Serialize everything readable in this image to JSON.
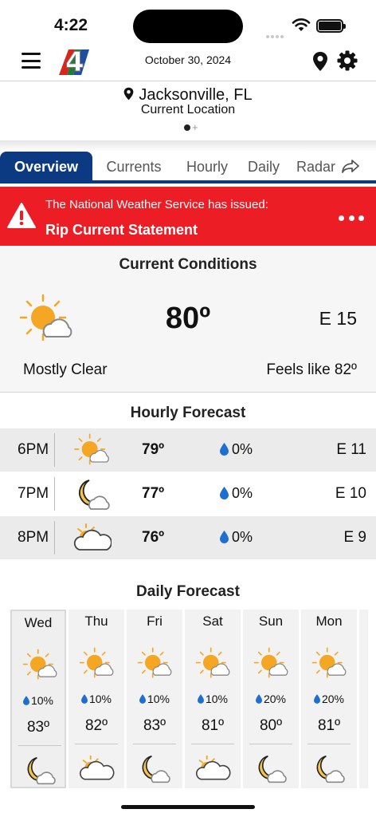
{
  "status_bar": {
    "time": "4:22"
  },
  "header": {
    "date": "October 30, 2024"
  },
  "location": {
    "city": "Jacksonville, FL",
    "subtitle": "Current Location"
  },
  "tabs": [
    {
      "label": "Overview",
      "active": true
    },
    {
      "label": "Currents",
      "active": false
    },
    {
      "label": "Hourly",
      "active": false
    },
    {
      "label": "Daily",
      "active": false
    },
    {
      "label": "Radar",
      "active": false
    }
  ],
  "alert": {
    "line1": "The National Weather Service has issued:",
    "line2": "Rip Current Statement",
    "color": "#ec1d24"
  },
  "current": {
    "title": "Current Conditions",
    "icon": "sun-cloud-icon",
    "temp": "80º",
    "wind": "E 15",
    "condition": "Mostly Clear",
    "feels_like": "Feels like 82º"
  },
  "hourly": {
    "title": "Hourly Forecast",
    "rows": [
      {
        "time": "6PM",
        "icon": "sun-cloud-icon",
        "temp": "79º",
        "precip": "0%",
        "wind": "E 11"
      },
      {
        "time": "7PM",
        "icon": "moon-cloud-icon",
        "temp": "77º",
        "precip": "0%",
        "wind": "E 10"
      },
      {
        "time": "8PM",
        "icon": "sunset-cloud-icon",
        "temp": "76º",
        "precip": "0%",
        "wind": "E 9"
      }
    ]
  },
  "daily": {
    "title": "Daily Forecast",
    "days": [
      {
        "name": "Wed",
        "icon": "sun-cloud-icon",
        "precip": "10%",
        "high": "83º",
        "night_icon": "moon-cloud-icon",
        "selected": true
      },
      {
        "name": "Thu",
        "icon": "sun-cloud-icon",
        "precip": "10%",
        "high": "82º",
        "night_icon": "moon-cloud-icon",
        "selected": false
      },
      {
        "name": "Fri",
        "icon": "sun-cloud-icon",
        "precip": "10%",
        "high": "83º",
        "night_icon": "moon-cloud-icon",
        "selected": false
      },
      {
        "name": "Sat",
        "icon": "sun-cloud-icon",
        "precip": "10%",
        "high": "81º",
        "night_icon": "moon-cloud-icon",
        "selected": false
      },
      {
        "name": "Sun",
        "icon": "sun-cloud-icon",
        "precip": "20%",
        "high": "80º",
        "night_icon": "moon-cloud-icon",
        "selected": false
      },
      {
        "name": "Mon",
        "icon": "sun-cloud-icon",
        "precip": "20%",
        "high": "81º",
        "night_icon": "moon-cloud-icon",
        "selected": false
      }
    ]
  },
  "colors": {
    "accent": "#0b3a82",
    "sun": "#f5a623",
    "drop": "#1f6fd1"
  }
}
